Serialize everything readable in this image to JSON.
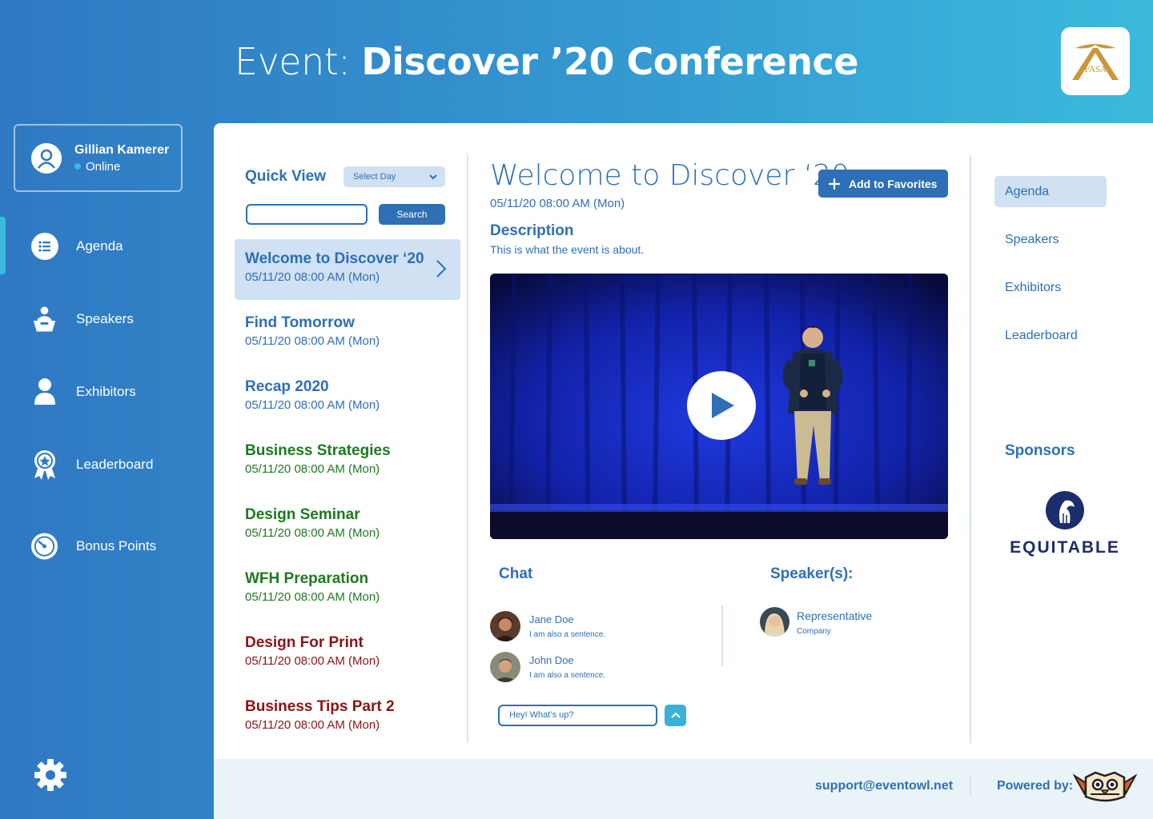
{
  "header": {
    "prefix": "Event: ",
    "event_name": "Discover ’20 Conference",
    "logo_text": "FASA"
  },
  "user": {
    "name": "Gillian Kamerer",
    "status": "Online"
  },
  "sidebar": {
    "items": [
      {
        "label": "Agenda",
        "icon": "list-icon"
      },
      {
        "label": "Speakers",
        "icon": "speaker-icon"
      },
      {
        "label": "Exhibitors",
        "icon": "person-icon"
      },
      {
        "label": "Leaderboard",
        "icon": "award-icon"
      },
      {
        "label": "Bonus Points",
        "icon": "gauge-icon"
      }
    ],
    "settings_icon": "gear-icon"
  },
  "quick_view": {
    "title": "Quick View",
    "select_day": "Select Day",
    "search_value": "",
    "search_label": "Search",
    "items": [
      {
        "title": "Welcome to Discover ‘20",
        "time": "05/11/20  08:00 AM  (Mon)",
        "color": "#2e6fb5"
      },
      {
        "title": "Find Tomorrow",
        "time": "05/11/20  08:00 AM  (Mon)",
        "color": "#2e6fb5"
      },
      {
        "title": "Recap 2020",
        "time": "05/11/20  08:00 AM  (Mon)",
        "color": "#2e6fb5"
      },
      {
        "title": "Business Strategies",
        "time": "05/11/20  08:00 AM  (Mon)",
        "color": "#1d7a1d"
      },
      {
        "title": "Design Seminar",
        "time": "05/11/20  08:00 AM  (Mon)",
        "color": "#1d7a1d"
      },
      {
        "title": "WFH Preparation",
        "time": "05/11/20  08:00 AM  (Mon)",
        "color": "#1d7a1d"
      },
      {
        "title": "Design For Print",
        "time": "05/11/20  08:00 AM  (Mon)",
        "color": "#8b1414"
      },
      {
        "title": "Business Tips Part 2",
        "time": "05/11/20  08:00 AM  (Mon)",
        "color": "#8b1414"
      }
    ]
  },
  "detail": {
    "title": "Welcome to Discover ‘20",
    "time": "05/11/20  08:00 AM  (Mon)",
    "favorite_label": "Add to Favorites",
    "description_label": "Description",
    "description": "This is what the event is about.",
    "chat_label": "Chat",
    "messages": [
      {
        "name": "Jane Doe",
        "text": "I am also a sentence."
      },
      {
        "name": "John Doe",
        "text": "I am also a sentence."
      }
    ],
    "chat_input_value": "Hey! What’s up?",
    "speakers_label": "Speaker(s):",
    "speaker": {
      "name": "Representative",
      "company": "Company"
    }
  },
  "right_nav": {
    "items": [
      "Agenda",
      "Speakers",
      "Exhibitors",
      "Leaderboard"
    ],
    "sponsors_label": "Sponsors",
    "sponsor_name": "EQUITABLE"
  },
  "footer": {
    "support_email": "support@eventowl.net",
    "powered_by": "Powered by:"
  },
  "colors": {
    "primary": "#2e6fb5",
    "accent": "#3bbadd",
    "selected_bg": "#cfe1f2"
  }
}
